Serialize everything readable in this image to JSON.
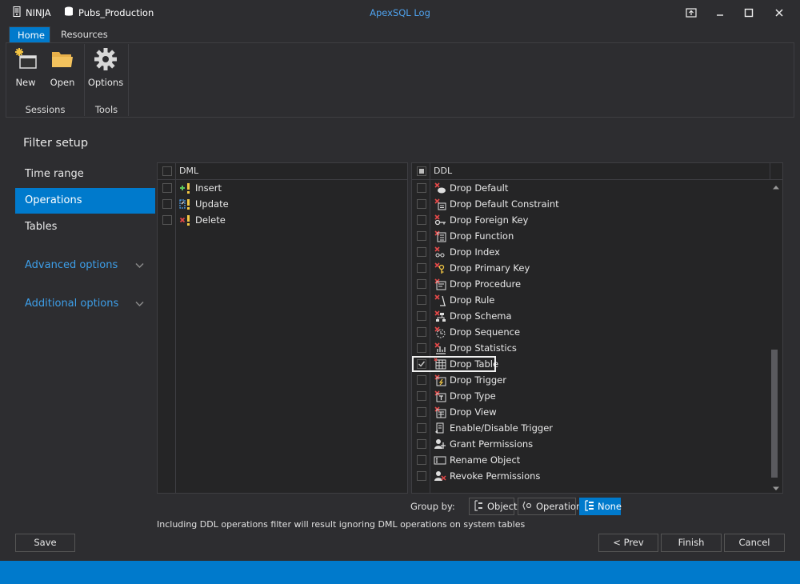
{
  "window": {
    "title": "ApexSQL Log"
  },
  "ribbon": {
    "tabs": [
      {
        "label": "Home"
      },
      {
        "label": "Resources"
      }
    ],
    "buttons": {
      "new": "New",
      "open": "Open",
      "options": "Options"
    },
    "groups": {
      "sessions": "Sessions",
      "tools": "Tools"
    }
  },
  "nav": {
    "title": "Filter setup",
    "items": [
      {
        "label": "Time range"
      },
      {
        "label": "Operations"
      },
      {
        "label": "Tables"
      },
      {
        "label": "Advanced options"
      },
      {
        "label": "Additional options"
      }
    ]
  },
  "dml": {
    "header": "DML",
    "items": [
      {
        "label": "Insert",
        "icon": "insert-icon"
      },
      {
        "label": "Update",
        "icon": "update-icon"
      },
      {
        "label": "Delete",
        "icon": "delete-icon"
      }
    ]
  },
  "ddl": {
    "header": "DDL",
    "items": [
      {
        "label": "Drop Default",
        "checked": false
      },
      {
        "label": "Drop Default Constraint",
        "checked": false
      },
      {
        "label": "Drop Foreign Key",
        "checked": false
      },
      {
        "label": "Drop Function",
        "checked": false
      },
      {
        "label": "Drop Index",
        "checked": false
      },
      {
        "label": "Drop Primary Key",
        "checked": false
      },
      {
        "label": "Drop Procedure",
        "checked": false
      },
      {
        "label": "Drop Rule",
        "checked": false
      },
      {
        "label": "Drop Schema",
        "checked": false
      },
      {
        "label": "Drop Sequence",
        "checked": false
      },
      {
        "label": "Drop Statistics",
        "checked": false
      },
      {
        "label": "Drop Table",
        "checked": true
      },
      {
        "label": "Drop Trigger",
        "checked": false
      },
      {
        "label": "Drop Type",
        "checked": false
      },
      {
        "label": "Drop View",
        "checked": false
      },
      {
        "label": "Enable/Disable Trigger",
        "checked": false
      },
      {
        "label": "Grant Permissions",
        "checked": false
      },
      {
        "label": "Rename Object",
        "checked": false
      },
      {
        "label": "Revoke Permissions",
        "checked": false
      }
    ]
  },
  "groupby": {
    "label": "Group by:",
    "object": "Object",
    "operation": "Operation",
    "none": "None",
    "selected": "None"
  },
  "note": "Including DDL operations filter will result ignoring DML operations on system tables",
  "footer": {
    "save": "Save",
    "prev": "< Prev",
    "finish": "Finish",
    "cancel": "Cancel"
  },
  "status": {
    "server": "NINJA",
    "database": "Pubs_Production"
  },
  "colors": {
    "accent": "#007acc",
    "background": "#2d2d30",
    "panel": "#252526",
    "link": "#3d9ee8"
  }
}
